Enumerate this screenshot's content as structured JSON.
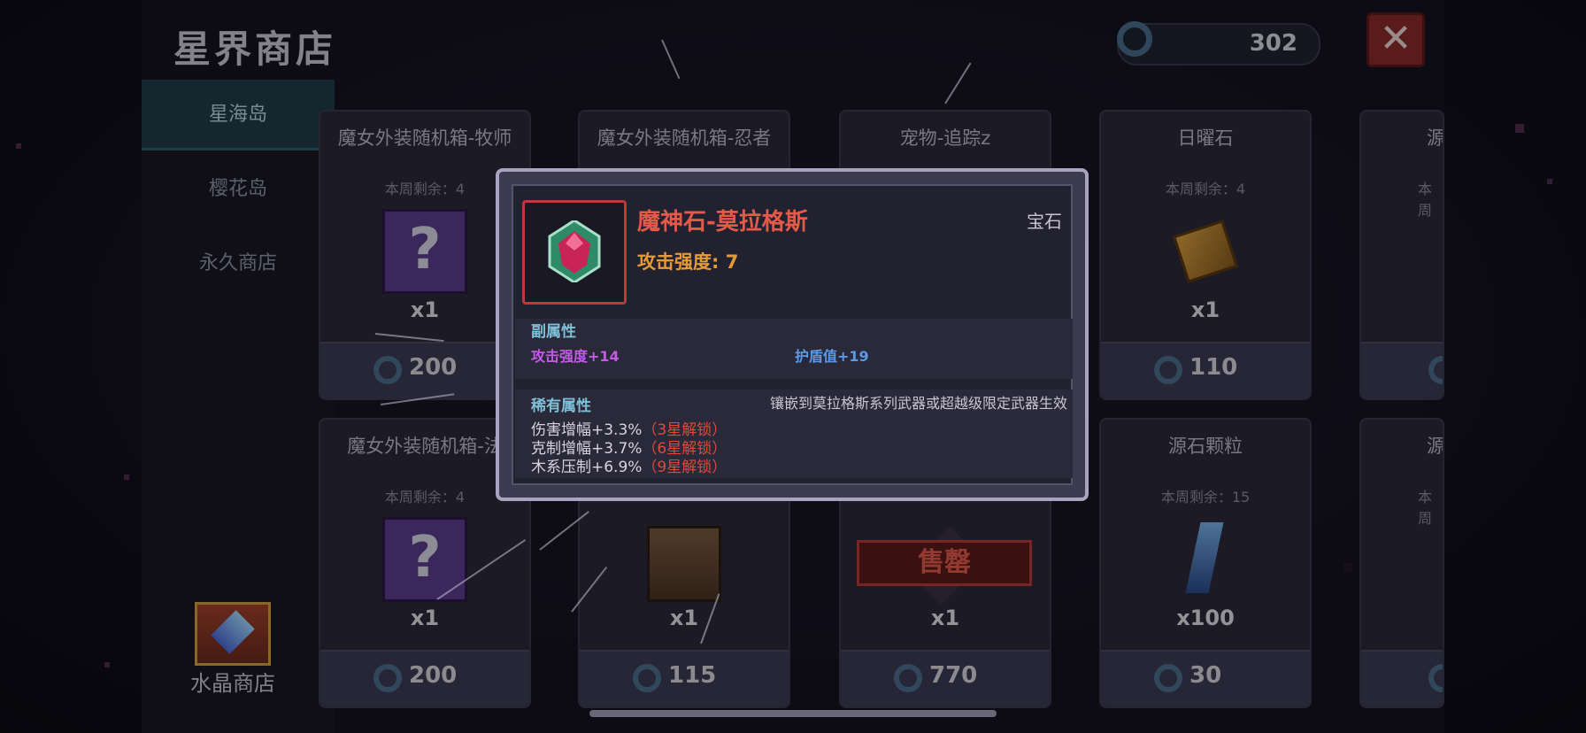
{
  "shop": {
    "title": "星界商店",
    "currency": "302",
    "close_label": "✕"
  },
  "sidebar": {
    "items": [
      "星海岛",
      "樱花岛",
      "永久商店"
    ],
    "crystal_shop": "水晶商店"
  },
  "cards": [
    {
      "name": "魔女外装随机箱-牧师",
      "remain": "本周剩余：4",
      "qty": "x1",
      "price": "200",
      "icon": "mystery-box"
    },
    {
      "name": "魔女外装随机箱-忍者",
      "remain": "",
      "qty": "",
      "price": "",
      "icon": ""
    },
    {
      "name": "宠物-追踪z",
      "remain": "",
      "qty": "",
      "price": "",
      "icon": ""
    },
    {
      "name": "日曜石",
      "remain": "本周剩余：4",
      "qty": "x1",
      "price": "110",
      "icon": "sun-stone"
    },
    {
      "name": "源",
      "remain": "本周",
      "qty": "",
      "price": "",
      "icon": ""
    },
    {
      "name": "魔女外装随机箱-法",
      "remain": "本周剩余：4",
      "qty": "x1",
      "price": "200",
      "icon": "mystery-box"
    },
    {
      "name": "",
      "remain": "",
      "qty": "x1",
      "price": "115",
      "icon": "treasure-chest"
    },
    {
      "name": "",
      "remain": "",
      "qty": "x1",
      "price": "770",
      "icon": "pet",
      "soldout": "售罄"
    },
    {
      "name": "源石颗粒",
      "remain": "本周剩余：15",
      "qty": "x100",
      "price": "30",
      "icon": "crystal-shard"
    },
    {
      "name": "源",
      "remain": "本周",
      "qty": "",
      "price": "",
      "icon": ""
    }
  ],
  "tooltip": {
    "name": "魔神石-莫拉格斯",
    "type": "宝石",
    "main_attr": "攻击强度: 7",
    "sub_title": "副属性",
    "sub_attr_1": "攻击强度+14",
    "sub_attr_2": "护盾值+19",
    "rare_title": "稀有属性",
    "rare_note": "镶嵌到莫拉格斯系列武器或超越级限定武器生效",
    "rare_1": "伤害增幅+3.3%",
    "rare_1_lock": "（3星解锁）",
    "rare_2": "克制增幅+3.7%",
    "rare_2_lock": "（6星解锁）",
    "rare_3": "木系压制+6.9%",
    "rare_3_lock": "（9星解锁）"
  },
  "colors": {
    "accent": "#e25a4a",
    "main_attr": "#e59a3a",
    "sub_attr_1": "#c45ae8",
    "sub_attr_2": "#5a9ae8",
    "section_title": "#7ec0d8"
  }
}
